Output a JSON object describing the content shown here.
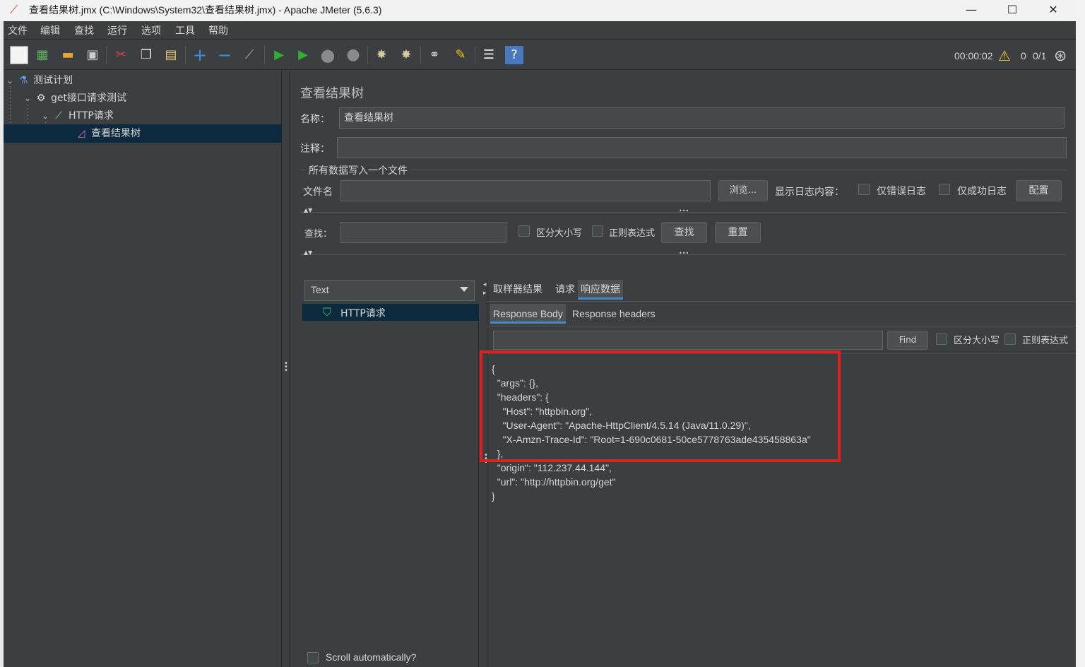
{
  "window": {
    "title": "查看结果树.jmx (C:\\Windows\\System32\\查看结果树.jmx) - Apache JMeter (5.6.3)",
    "minimize": "—",
    "maximize": "☐",
    "close": "✕"
  },
  "menu": [
    "文件",
    "编辑",
    "查找",
    "运行",
    "选项",
    "工具",
    "帮助"
  ],
  "toolbar_status": {
    "elapsed": "00:00:02",
    "warnings": "0",
    "threads": "0/1"
  },
  "tree": {
    "root": "测试计划",
    "thread_group": "get接口请求测试",
    "sampler": "HTTP请求",
    "listener": "查看结果树"
  },
  "panel": {
    "title": "查看结果树",
    "name_label": "名称：",
    "name_value": "查看结果树",
    "comment_label": "注释：",
    "comment_value": "",
    "file_group_label": "所有数据写入一个文件",
    "filename_label": "文件名",
    "filename_value": "",
    "browse_button": "浏览...",
    "log_label": "显示日志内容：",
    "errors_only": "仅错误日志",
    "success_only": "仅成功日志",
    "configure_button": "配置",
    "search_label": "查找：",
    "search_value": "",
    "case_sensitive": "区分大小写",
    "regex": "正则表达式",
    "find_button": "查找",
    "reset_button": "重置"
  },
  "results": {
    "renderer": "Text",
    "items": [
      "HTTP请求"
    ],
    "scroll_auto": "Scroll automatically?",
    "tabs": [
      "取样器结果",
      "请求",
      "响应数据"
    ],
    "active_tab": "响应数据",
    "subtabs": [
      "Response Body",
      "Response headers"
    ],
    "active_subtab": "Response Body",
    "find_button": "Find",
    "find_value": "",
    "case_sensitive": "区分大小写",
    "regex": "正则表达式",
    "body": "{\n  \"args\": {}, \n  \"headers\": {\n    \"Host\": \"httpbin.org\", \n    \"User-Agent\": \"Apache-HttpClient/4.5.14 (Java/11.0.29)\", \n    \"X-Amzn-Trace-Id\": \"Root=1-690c0681-50ce5778763ade435458863a\"\n  }, \n  \"origin\": \"112.237.44.144\", \n  \"url\": \"http://httpbin.org/get\"\n}"
  },
  "colors": {
    "background": "#3c3f41",
    "selection": "#0d293e",
    "accent": "#4a88c7",
    "highlight_box": "#e02020"
  }
}
